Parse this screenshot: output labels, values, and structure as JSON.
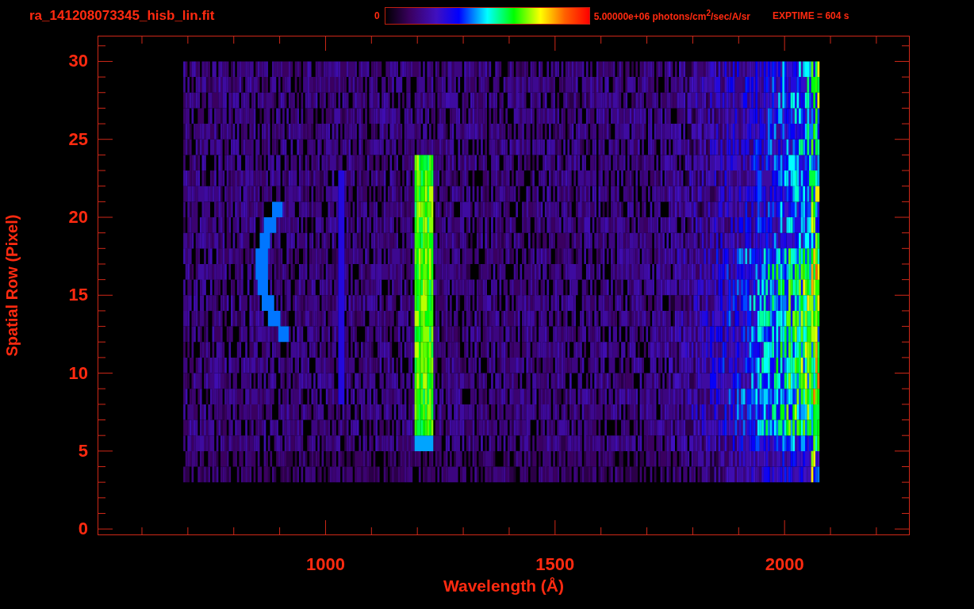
{
  "plot": {
    "title": "ra_141208073345_hisb_lin.fit",
    "colorbar": {
      "min_label": "0",
      "max_label": "5.00000e+06 photons/cm$^{2}$/sec/A/sr"
    },
    "exposure": "EXPTIME = 604 s",
    "ylabel": "Spatial Row (Pixel)",
    "yticks": [
      "30",
      "25",
      "20",
      "15",
      "10",
      "5",
      "0"
    ],
    "xlabel": "Wavelength (Å)",
    "xticks": [
      "1000",
      "1500",
      "2000"
    ]
  }
}
